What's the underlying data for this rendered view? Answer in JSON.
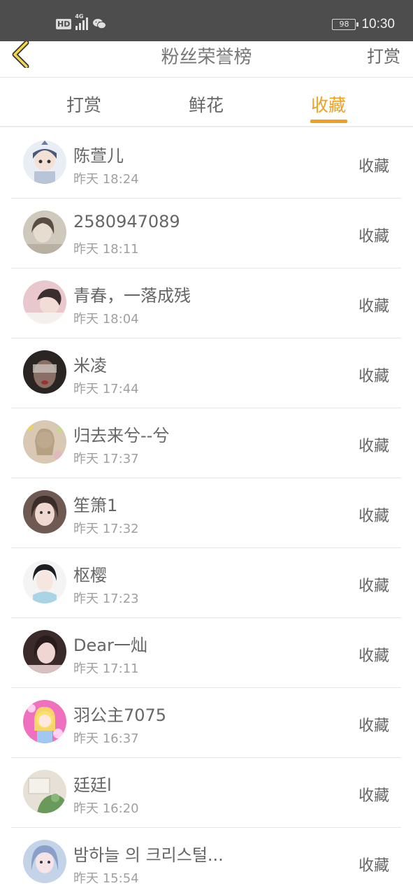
{
  "status_bar": {
    "hd": "HD",
    "network": "4G",
    "battery": "98",
    "time": "10:30",
    "icons": [
      "hd-icon",
      "signal-icon",
      "wechat-icon",
      "battery-icon"
    ]
  },
  "navbar": {
    "back_icon": "chevron-left-icon",
    "title": "粉丝荣誉榜",
    "right_label": "打赏"
  },
  "tabs": [
    {
      "label": "打赏",
      "active": false
    },
    {
      "label": "鲜花",
      "active": false
    },
    {
      "label": "收藏",
      "active": true
    }
  ],
  "colors": {
    "accent": "#f0a021",
    "status_bar": "#4d4d4d",
    "text": "#666666",
    "subtext": "#a0a0a0",
    "divider": "#e6e6e6"
  },
  "fans": [
    {
      "name": "陈萱儿",
      "time": "昨天 18:24",
      "action": "收藏"
    },
    {
      "name": "2580947089",
      "time": "昨天 18:11",
      "action": "收藏"
    },
    {
      "name": "青春，一落成残",
      "time": "昨天 18:04",
      "action": "收藏"
    },
    {
      "name": "米凌",
      "time": "昨天 17:44",
      "action": "收藏"
    },
    {
      "name": "归去来兮--兮",
      "time": "昨天 17:37",
      "action": "收藏"
    },
    {
      "name": "笙箫1",
      "time": "昨天 17:32",
      "action": "收藏"
    },
    {
      "name": "枢樱",
      "time": "昨天 17:23",
      "action": "收藏"
    },
    {
      "name": "Dear一灿",
      "time": "昨天 17:11",
      "action": "收藏"
    },
    {
      "name": "羽公主7075",
      "time": "昨天 16:37",
      "action": "收藏"
    },
    {
      "name": "廷廷l",
      "time": "昨天 16:20",
      "action": "收藏"
    },
    {
      "name": "밤하늘 의 크리스털...",
      "time": "昨天 15:54",
      "action": "收藏"
    }
  ]
}
